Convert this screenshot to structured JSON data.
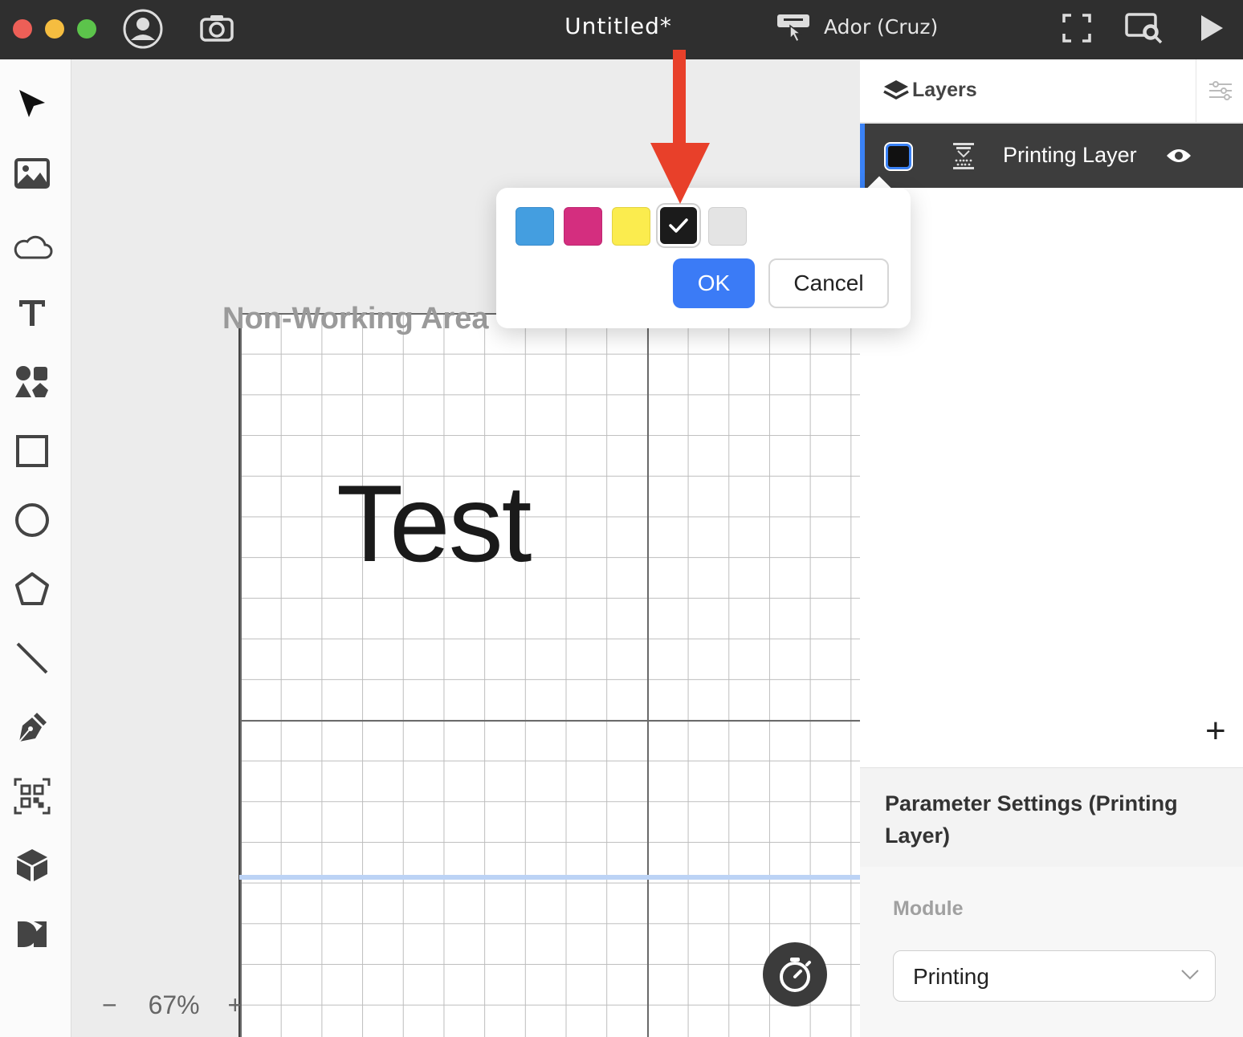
{
  "window": {
    "title": "Untitled*",
    "device": "Ador (Cruz)"
  },
  "toolbar": {
    "tools": [
      "select-icon",
      "image-icon",
      "cloud-icon",
      "text-icon",
      "elements-icon",
      "rectangle-icon",
      "ellipse-icon",
      "polygon-icon",
      "line-icon",
      "pen-icon",
      "qr-code-icon",
      "3d-box-icon",
      "design-market-icon"
    ]
  },
  "canvas": {
    "non_working_label": "Non-Working Area",
    "text_object": "Test",
    "zoom_out": "−",
    "zoom_level": "67%",
    "zoom_in": "+"
  },
  "layers": {
    "title": "Layers",
    "items": [
      {
        "name": "Printing Layer",
        "color": "#111111"
      }
    ],
    "add_label": "+"
  },
  "parameters": {
    "title": "Parameter Settings (Printing Layer)",
    "module_label": "Module",
    "module_value": "Printing"
  },
  "color_picker": {
    "swatches": [
      {
        "color": "#449ee0",
        "selected": false
      },
      {
        "color": "#d42e7f",
        "selected": false
      },
      {
        "color": "#fbec4e",
        "selected": false
      },
      {
        "color": "#1b1b1b",
        "selected": true
      },
      {
        "color": "#e4e4e4",
        "selected": false
      }
    ],
    "ok_label": "OK",
    "cancel_label": "Cancel"
  },
  "colors": {
    "accent": "#3b7bf6",
    "annotation_arrow": "#e8402a"
  }
}
